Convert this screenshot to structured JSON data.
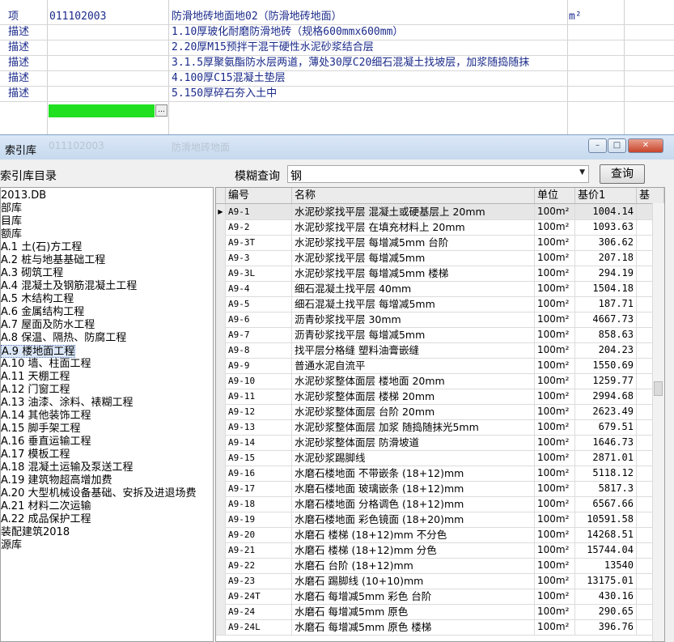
{
  "sheet": {
    "rows": [
      {
        "type": "项",
        "code": "011102003",
        "desc": "防滑地砖地面地02（防滑地砖地面）",
        "unit": "m²"
      },
      {
        "type": "描述",
        "code": "",
        "desc": "1.10厚玻化耐磨防滑地砖（规格600mmx600mm）",
        "unit": ""
      },
      {
        "type": "描述",
        "code": "",
        "desc": "2.20厚M15预拌干混干硬性水泥砂浆结合层",
        "unit": ""
      },
      {
        "type": "描述",
        "code": "",
        "desc": "3.1.5厚聚氨酯防水层两道，薄处30厚C20细石混凝土找坡层，加浆随捣随抹",
        "unit": ""
      },
      {
        "type": "描述",
        "code": "",
        "desc": "4.100厚C15混凝土垫层",
        "unit": ""
      },
      {
        "type": "描述",
        "code": "",
        "desc": "5.150厚碎石夯入土中",
        "unit": ""
      }
    ],
    "ellipsis": "..."
  },
  "dialog": {
    "title": "索引库",
    "ghost_title_left": "011102003",
    "ghost_title_right": "防滑地砖地面",
    "btn_min": "–",
    "btn_max": "□",
    "btn_close": "✕",
    "tree_label": "索引库目录",
    "fuzzy_label": "模糊查询",
    "search_value": "钢",
    "query_button": "查询"
  },
  "tree": [
    "2013.DB",
    "部库",
    "目库",
    "额库",
    "A.1 土(石)方工程",
    "A.2 桩与地基基础工程",
    "A.3 砌筑工程",
    "A.4 混凝土及钢筋混凝土工程",
    "A.5 木结构工程",
    "A.6 金属结构工程",
    "A.7 屋面及防水工程",
    "A.8 保温、隔热、防腐工程",
    "A.9 楼地面工程",
    "A.10 墙、柱面工程",
    "A.11 天棚工程",
    "A.12 门窗工程",
    "A.13 油漆、涂料、裱糊工程",
    "A.14 其他装饰工程",
    "A.15 脚手架工程",
    "A.16 垂直运输工程",
    "A.17 模板工程",
    "A.18 混凝土运输及泵送工程",
    "A.19 建筑物超高增加费",
    "A.20 大型机械设备基础、安拆及进退场费",
    "A.21 材料二次运输",
    "A.22 成品保护工程",
    "装配建筑2018",
    "源库"
  ],
  "tree_selected_index": 12,
  "grid": {
    "headers": {
      "code": "编号",
      "name": "名称",
      "unit": "单位",
      "price": "基价1",
      "extra": "基"
    },
    "current_row_index": 0,
    "rows": [
      {
        "code": "A9-1",
        "name": "水泥砂浆找平层 混凝土或硬基层上 20mm",
        "unit": "100m²",
        "price": "1004.14"
      },
      {
        "code": "A9-2",
        "name": "水泥砂浆找平层 在填充材料上 20mm",
        "unit": "100m²",
        "price": "1093.63"
      },
      {
        "code": "A9-3T",
        "name": "水泥砂浆找平层 每增减5mm 台阶",
        "unit": "100m²",
        "price": "306.62"
      },
      {
        "code": "A9-3",
        "name": "水泥砂浆找平层 每增减5mm",
        "unit": "100m²",
        "price": "207.18"
      },
      {
        "code": "A9-3L",
        "name": "水泥砂浆找平层 每增减5mm 楼梯",
        "unit": "100m²",
        "price": "294.19"
      },
      {
        "code": "A9-4",
        "name": "细石混凝土找平层 40mm",
        "unit": "100m²",
        "price": "1504.18"
      },
      {
        "code": "A9-5",
        "name": "细石混凝土找平层 每增减5mm",
        "unit": "100m²",
        "price": "187.71"
      },
      {
        "code": "A9-6",
        "name": "沥青砂浆找平层 30mm",
        "unit": "100m²",
        "price": "4667.73"
      },
      {
        "code": "A9-7",
        "name": "沥青砂浆找平层 每增减5mm",
        "unit": "100m²",
        "price": "858.63"
      },
      {
        "code": "A9-8",
        "name": "找平层分格缝 塑料油膏嵌缝",
        "unit": "100m²",
        "price": "204.23"
      },
      {
        "code": "A9-9",
        "name": "普通水泥自流平",
        "unit": "100m²",
        "price": "1550.69"
      },
      {
        "code": "A9-10",
        "name": "水泥砂浆整体面层 楼地面 20mm",
        "unit": "100m²",
        "price": "1259.77"
      },
      {
        "code": "A9-11",
        "name": "水泥砂浆整体面层 楼梯 20mm",
        "unit": "100m²",
        "price": "2994.68"
      },
      {
        "code": "A9-12",
        "name": "水泥砂浆整体面层 台阶 20mm",
        "unit": "100m²",
        "price": "2623.49"
      },
      {
        "code": "A9-13",
        "name": "水泥砂浆整体面层 加浆 随捣随抹光5mm",
        "unit": "100m²",
        "price": "679.51"
      },
      {
        "code": "A9-14",
        "name": "水泥砂浆整体面层 防滑坡道",
        "unit": "100m²",
        "price": "1646.73"
      },
      {
        "code": "A9-15",
        "name": "水泥砂浆踢脚线",
        "unit": "100m²",
        "price": "2871.01"
      },
      {
        "code": "A9-16",
        "name": "水磨石楼地面 不带嵌条 (18+12)mm",
        "unit": "100m²",
        "price": "5118.12"
      },
      {
        "code": "A9-17",
        "name": "水磨石楼地面 玻璃嵌条 (18+12)mm",
        "unit": "100m²",
        "price": "5817.3"
      },
      {
        "code": "A9-18",
        "name": "水磨石楼地面 分格调色 (18+12)mm",
        "unit": "100m²",
        "price": "6567.66"
      },
      {
        "code": "A9-19",
        "name": "水磨石楼地面 彩色镜面 (18+20)mm",
        "unit": "100m²",
        "price": "10591.58"
      },
      {
        "code": "A9-20",
        "name": "水磨石 楼梯 (18+12)mm 不分色",
        "unit": "100m²",
        "price": "14268.51"
      },
      {
        "code": "A9-21",
        "name": "水磨石 楼梯 (18+12)mm 分色",
        "unit": "100m²",
        "price": "15744.04"
      },
      {
        "code": "A9-22",
        "name": "水磨石 台阶 (18+12)mm",
        "unit": "100m²",
        "price": "13540"
      },
      {
        "code": "A9-23",
        "name": "水磨石 踢脚线 (10+10)mm",
        "unit": "100m²",
        "price": "13175.01"
      },
      {
        "code": "A9-24T",
        "name": "水磨石 每增减5mm 彩色 台阶",
        "unit": "100m²",
        "price": "430.16"
      },
      {
        "code": "A9-24",
        "name": "水磨石 每增减5mm 原色",
        "unit": "100m²",
        "price": "290.65"
      },
      {
        "code": "A9-24L",
        "name": "水磨石 每增减5mm 原色 楼梯",
        "unit": "100m²",
        "price": "396.76"
      }
    ]
  }
}
